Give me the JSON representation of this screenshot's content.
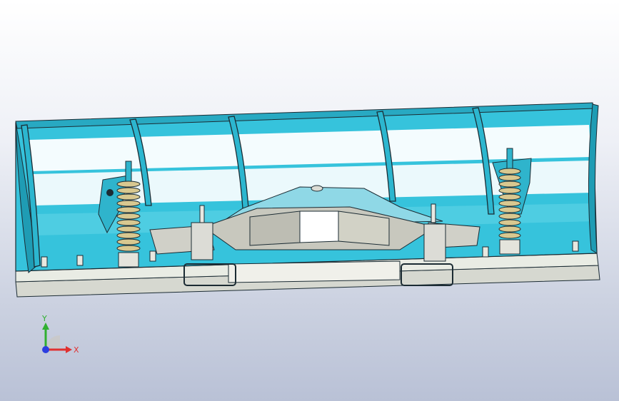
{
  "viewport": {
    "background_top": "#ffffff",
    "background_bottom": "#b9c1d6"
  },
  "model": {
    "blade_color": "#36c3dc",
    "blade_highlight": "#ffffff",
    "edge_color": "#1b2b33",
    "metal_color": "#d9d9d4",
    "spring_color": "#c9b27a"
  },
  "triad": {
    "x_label": "X",
    "y_label": "Y",
    "x_color": "#e03030",
    "y_color": "#30b030",
    "z_color": "#2c3ee0"
  }
}
